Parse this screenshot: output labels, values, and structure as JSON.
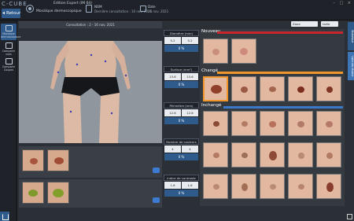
{
  "app": {
    "logo": "C-CUBE",
    "edition": "Edition Expert  (IM 64)",
    "window_controls": "– □ ×"
  },
  "header": {
    "back_label": "Retour",
    "title": "Mosaïque dermoscopique",
    "patient_name": "NOM",
    "patient_meta": "Dernière consultation : 16 nov. 2021",
    "date_label": "Date",
    "date_value": "16 nov. 2021"
  },
  "sidebar": {
    "items": [
      {
        "label": "Mosaïque dermoscopique"
      },
      {
        "label": "Comparer vues"
      },
      {
        "label": "Comparer Coupes"
      }
    ]
  },
  "center": {
    "consult_label": "Consultation : 2  -  16 nov. 2021"
  },
  "metrics": [
    {
      "title": "Diamètre (mm)",
      "v1": "5.2",
      "v2": "5.2",
      "delta": "0 %"
    },
    {
      "title": "Surface (mm²)",
      "v1": "13.6",
      "v2": "13.6",
      "delta": "0 %"
    },
    {
      "title": "Périmètre (mm)",
      "v1": "12.8",
      "v2": "12.8",
      "delta": "0 %"
    },
    {
      "title": "Nombre de couleurs",
      "v1": "4",
      "v2": "4",
      "delta": "0 %"
    },
    {
      "title": "Indice de contraste",
      "v1": "1.6",
      "v2": "1.6",
      "delta": "0 %"
    }
  ],
  "gallery": {
    "section_new": "Nouveau",
    "section_changed": "Changé",
    "section_unchanged": "Inchangé",
    "colors": {
      "new": "#c8262d",
      "changed": "#f0962a",
      "unchanged": "#3c78c8"
    }
  },
  "controls": {
    "zone_select": "Zone",
    "view_select": "taille",
    "right_tab_1": "Historique",
    "right_tab_2": "Liste des lésions"
  },
  "icons": [
    "back-arrow-icon",
    "mosaic-icon",
    "avatar-icon",
    "calendar-icon",
    "camera-icon",
    "home-icon",
    "print-icon"
  ]
}
